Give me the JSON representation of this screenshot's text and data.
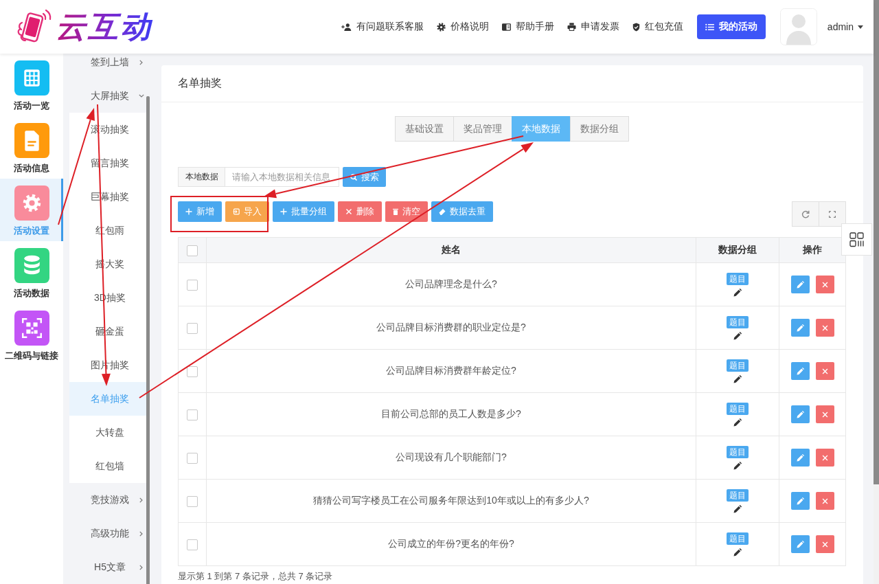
{
  "header": {
    "logo": "云互动",
    "links": [
      "有问题联系客服",
      "价格说明",
      "帮助手册",
      "申请发票",
      "红包充值"
    ],
    "primary_button": "我的活动",
    "user": "admin"
  },
  "nav": [
    {
      "label": "活动一览",
      "color": "#14bdf2",
      "selected": false
    },
    {
      "label": "活动信息",
      "color": "#ff9a0c",
      "selected": false
    },
    {
      "label": "活动设置",
      "color": "#f98b9b",
      "selected": true
    },
    {
      "label": "活动数据",
      "color": "#33d582",
      "selected": false
    },
    {
      "label": "二维码与链接",
      "color": "#c355f6",
      "selected": false
    }
  ],
  "menu": [
    {
      "label": "签到上墙",
      "expanded": false
    },
    {
      "label": "大屏抽奖",
      "expanded": true,
      "children": [
        {
          "label": "滚动抽奖",
          "selected": false
        },
        {
          "label": "留言抽奖",
          "selected": false
        },
        {
          "label": "巨幕抽奖",
          "selected": false
        },
        {
          "label": "红包雨",
          "selected": false
        },
        {
          "label": "摇大奖",
          "selected": false
        },
        {
          "label": "3D抽奖",
          "selected": false
        },
        {
          "label": "砸金蛋",
          "selected": false
        },
        {
          "label": "图片抽奖",
          "selected": false
        },
        {
          "label": "名单抽奖",
          "selected": true
        },
        {
          "label": "大转盘",
          "selected": false
        },
        {
          "label": "红包墙",
          "selected": false
        }
      ]
    },
    {
      "label": "竞技游戏",
      "expanded": false
    },
    {
      "label": "高级功能",
      "expanded": false
    },
    {
      "label": "H5文章",
      "expanded": false
    }
  ],
  "panel": {
    "title": "名单抽奖",
    "tabs": [
      {
        "label": "基础设置",
        "selected": false
      },
      {
        "label": "奖品管理",
        "selected": false
      },
      {
        "label": "本地数据",
        "selected": true
      },
      {
        "label": "数据分组",
        "selected": false
      }
    ],
    "search": {
      "label": "本地数据",
      "placeholder": "请输入本地数据相关信息",
      "button": "搜索"
    },
    "toolbar": [
      {
        "label": "新增",
        "kind": "primary"
      },
      {
        "label": "导入",
        "kind": "warning"
      },
      {
        "label": "批量分组",
        "kind": "primary"
      },
      {
        "label": "删除",
        "kind": "danger"
      },
      {
        "label": "清空",
        "kind": "danger"
      },
      {
        "label": "数据去重",
        "kind": "primary"
      }
    ],
    "table": {
      "select_all": false,
      "columns": [
        "姓名",
        "数据分组",
        "操作"
      ],
      "rows": [
        {
          "checked": false,
          "name": "公司品牌理念是什么?",
          "group": "题目"
        },
        {
          "checked": false,
          "name": "公司品牌目标消费群的职业定位是?",
          "group": "题目"
        },
        {
          "checked": false,
          "name": "公司品牌目标消费群年龄定位?",
          "group": "题目"
        },
        {
          "checked": false,
          "name": "目前公司总部的员工人数是多少?",
          "group": "题目"
        },
        {
          "checked": false,
          "name": "公司现设有几个职能部门?",
          "group": "题目"
        },
        {
          "checked": false,
          "name": "猜猜公司写字楼员工在公司服务年限达到10年或以上的有多少人?",
          "group": "题目"
        },
        {
          "checked": false,
          "name": "公司成立的年份?更名的年份?",
          "group": "题目"
        }
      ]
    },
    "footer": "显示第 1 到第 7 条记录，总共 7 条记录"
  },
  "annotations": [
    {
      "kind": "arrow"
    },
    {
      "kind": "arrow"
    },
    {
      "kind": "arrow"
    },
    {
      "kind": "arrow"
    },
    {
      "kind": "frame"
    }
  ]
}
